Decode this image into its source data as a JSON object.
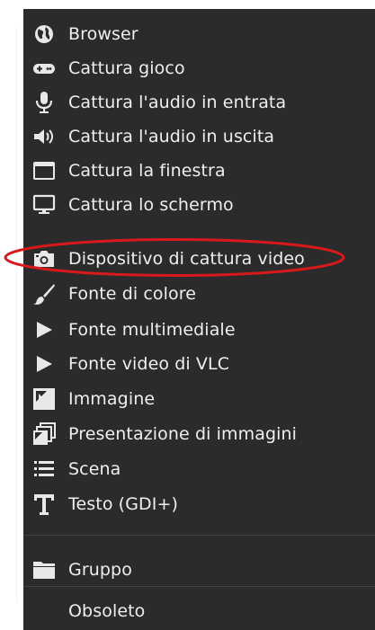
{
  "menu": {
    "items": [
      {
        "label": "Browser",
        "icon": "globe-icon"
      },
      {
        "label": "Cattura gioco",
        "icon": "gamepad-icon"
      },
      {
        "label": "Cattura l'audio in entrata",
        "icon": "microphone-icon"
      },
      {
        "label": "Cattura l'audio in uscita",
        "icon": "speaker-icon"
      },
      {
        "label": "Cattura la finestra",
        "icon": "window-icon"
      },
      {
        "label": "Cattura lo schermo",
        "icon": "monitor-icon"
      },
      {
        "label": "Dispositivo di cattura video",
        "icon": "camera-icon"
      },
      {
        "label": "Fonte di colore",
        "icon": "paintbrush-icon"
      },
      {
        "label": "Fonte multimediale",
        "icon": "play-icon"
      },
      {
        "label": "Fonte video di VLC",
        "icon": "play-icon"
      },
      {
        "label": "Immagine",
        "icon": "image-icon"
      },
      {
        "label": "Presentazione di immagini",
        "icon": "slideshow-icon"
      },
      {
        "label": "Scena",
        "icon": "list-icon"
      },
      {
        "label": "Testo (GDI+)",
        "icon": "text-icon"
      },
      {
        "label": "Gruppo",
        "icon": "folder-icon"
      },
      {
        "label": "Obsoleto",
        "icon": ""
      }
    ],
    "highlight_color": "#d7191c",
    "background_color": "#2b2b2b",
    "text_color": "#efefef"
  }
}
